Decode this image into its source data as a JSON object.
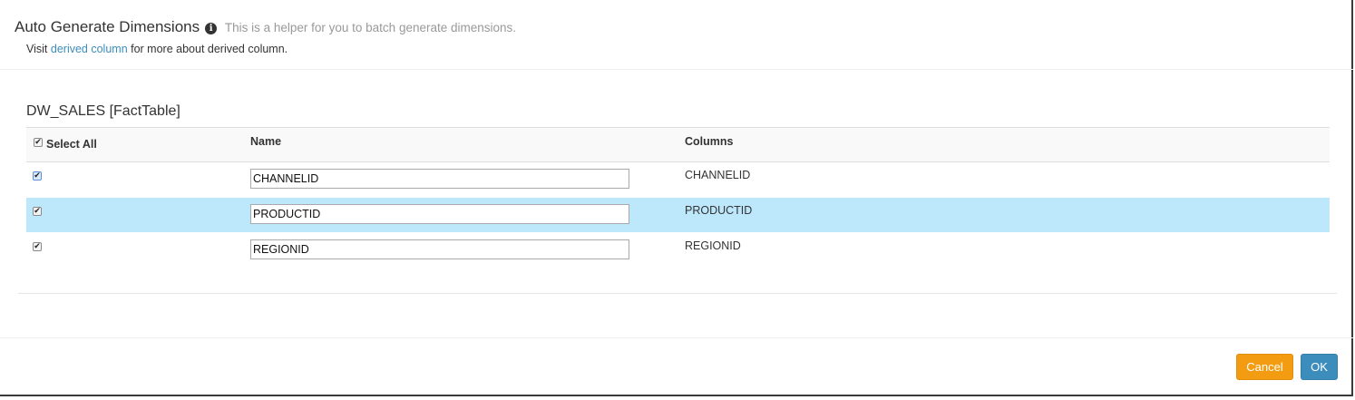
{
  "header": {
    "title": "Auto Generate Dimensions",
    "helper_text": "This is a helper for you to batch generate dimensions.",
    "visit_prefix": "Visit",
    "link_text": "derived column",
    "visit_suffix": "for more about derived column."
  },
  "table": {
    "title": "DW_SALES [FactTable]",
    "select_all_label": "Select All",
    "select_all_checked": true,
    "columns": [
      "Name",
      "Columns"
    ],
    "rows": [
      {
        "checked": true,
        "name": "CHANNELID",
        "column": "CHANNELID",
        "highlighted": false
      },
      {
        "checked": true,
        "name": "PRODUCTID",
        "column": "PRODUCTID",
        "highlighted": true
      },
      {
        "checked": true,
        "name": "REGIONID",
        "column": "REGIONID",
        "highlighted": false
      }
    ]
  },
  "footer": {
    "cancel_label": "Cancel",
    "ok_label": "OK"
  },
  "colors": {
    "cancel_button": "#f39c12",
    "ok_button": "#3c8dbc",
    "link": "#3c8dbc",
    "row_highlight": "#bde8fb"
  },
  "icons": {
    "info": "info-circle-icon",
    "checkbox": "checkbox-checked-icon"
  }
}
